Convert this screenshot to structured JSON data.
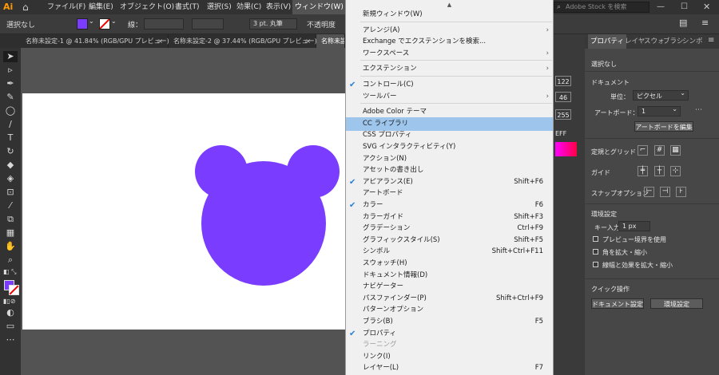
{
  "app": {
    "logo": "Ai"
  },
  "menubar": {
    "items": [
      "ファイル(F)",
      "編集(E)",
      "オブジェクト(O)",
      "書式(T)",
      "選択(S)",
      "効果(C)",
      "表示(V)",
      "ウィンドウ(W)"
    ],
    "stock_search_placeholder": "Adobe Stock を検索"
  },
  "control_bar": {
    "selection": "選択なし",
    "fill_color": "#7a3cff",
    "stroke_label": "線：",
    "stroke_style": "3 pt. 丸筆",
    "opacity_label": "不透明度"
  },
  "tabs": [
    {
      "label": "名称未設定-1 @ 41.84% (RGB/GPU プレビュー)",
      "close": "×"
    },
    {
      "label": "名称未設定-2 @ 37.44% (RGB/GPU プレビュー)",
      "close": "×"
    },
    {
      "label": "名称未設"
    }
  ],
  "canvas": {
    "shape_color": "#7a3cff"
  },
  "window_menu": {
    "items": [
      {
        "label": "新規ウィンドウ(W)"
      },
      {
        "sep": true
      },
      {
        "label": "アレンジ(A)",
        "submenu": true
      },
      {
        "label": "Exchange でエクステンションを検索..."
      },
      {
        "label": "ワークスペース",
        "submenu": true
      },
      {
        "sep": true
      },
      {
        "label": "エクステンション",
        "submenu": true
      },
      {
        "sep": true
      },
      {
        "label": "コントロール(C)",
        "checked": true
      },
      {
        "label": "ツールバー",
        "submenu": true
      },
      {
        "sep": true
      },
      {
        "label": "Adobe Color テーマ"
      },
      {
        "label": "CC ライブラリ",
        "highlighted": true
      },
      {
        "label": "CSS プロパティ"
      },
      {
        "label": "SVG インタラクティビティ(Y)"
      },
      {
        "label": "アクション(N)"
      },
      {
        "label": "アセットの書き出し"
      },
      {
        "label": "アピアランス(E)",
        "shortcut": "Shift+F6",
        "checked": true
      },
      {
        "label": "アートボード"
      },
      {
        "label": "カラー",
        "shortcut": "F6",
        "checked": true
      },
      {
        "label": "カラーガイド",
        "shortcut": "Shift+F3"
      },
      {
        "label": "グラデーション",
        "shortcut": "Ctrl+F9"
      },
      {
        "label": "グラフィックスタイル(S)",
        "shortcut": "Shift+F5"
      },
      {
        "label": "シンボル",
        "shortcut": "Shift+Ctrl+F11"
      },
      {
        "label": "スウォッチ(H)"
      },
      {
        "label": "ドキュメント情報(D)"
      },
      {
        "label": "ナビゲーター"
      },
      {
        "label": "パスファインダー(P)",
        "shortcut": "Shift+Ctrl+F9"
      },
      {
        "label": "パターンオプション"
      },
      {
        "label": "ブラシ(B)",
        "shortcut": "F5"
      },
      {
        "label": "プロパティ",
        "checked": true
      },
      {
        "label": "ラーニング",
        "disabled": true
      },
      {
        "label": "リンク(I)"
      },
      {
        "label": "レイヤー(L)",
        "shortcut": "F7"
      }
    ]
  },
  "mid_panel": {
    "values": [
      "122",
      "46",
      "255"
    ],
    "hex": "EFF"
  },
  "properties_panel": {
    "tabs": [
      "プロパティ",
      "レイヤ",
      "スウォ",
      "ブラシ",
      "シンボ"
    ],
    "selection": "選択なし",
    "document_heading": "ドキュメント",
    "unit_label": "単位：",
    "unit_value": "ピクセル",
    "artboard_label": "アートボード：",
    "artboard_value": "1",
    "edit_artboard_button": "アートボードを編集",
    "rulers_grid_label": "定規とグリッド",
    "guides_label": "ガイド",
    "snap_label": "スナップオプション",
    "prefs_heading": "環境設定",
    "key_increment_label": "キー入力：",
    "key_increment_value": "1 px",
    "checkboxes": [
      "プレビュー境界を使用",
      "角を拡大・縮小",
      "線幅と効果を拡大・縮小"
    ],
    "quick_actions_heading": "クイック操作",
    "doc_setup_button": "ドキュメント設定",
    "prefs_button": "環境設定"
  }
}
